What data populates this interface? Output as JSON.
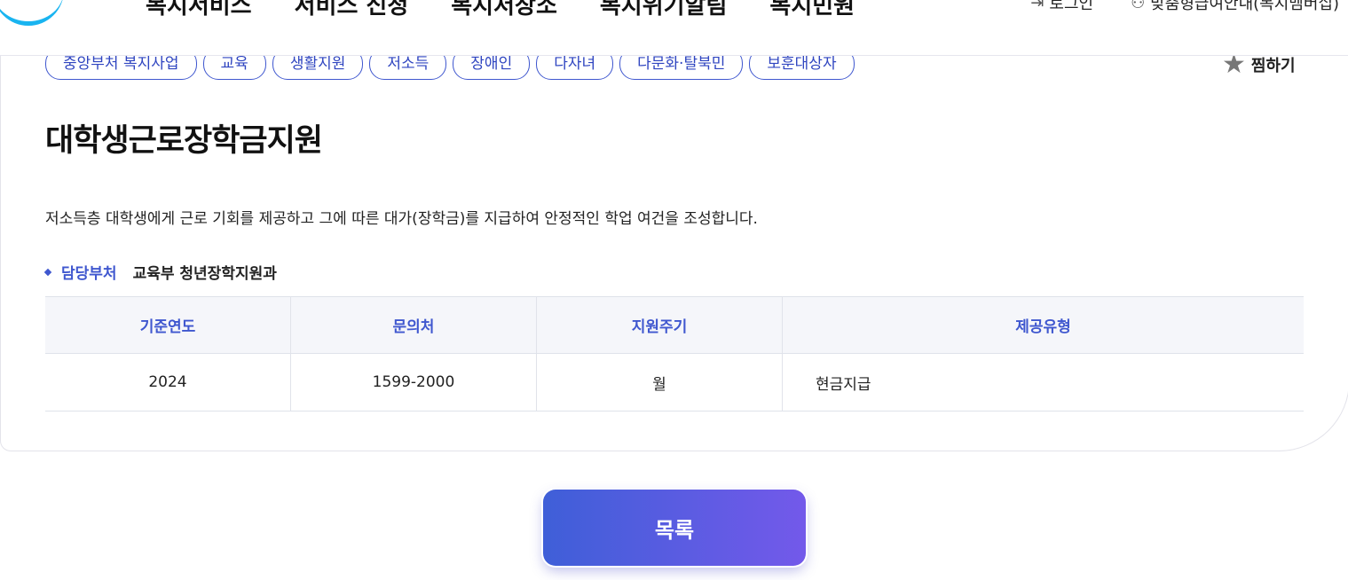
{
  "header": {
    "nav": [
      "복지서비스",
      "서비스 신청",
      "복지저장소",
      "복지위기알림",
      "복지민원"
    ],
    "login_label": "로그인",
    "guide_label": "맞춤형급여안내(복지멤버십)"
  },
  "tags": [
    "중앙부처 복지사업",
    "교육",
    "생활지원",
    "저소득",
    "장애인",
    "다자녀",
    "다문화·탈북민",
    "보훈대상자"
  ],
  "favorite_label": "찜하기",
  "title": "대학생근로장학금지원",
  "description": "저소득층 대학생에게 근로 기회를 제공하고 그에 따른 대가(장학금)를 지급하여 안정적인 학업 여건을 조성합니다.",
  "department": {
    "label": "담당부처",
    "value": "교육부 청년장학지원과"
  },
  "table": {
    "headers": [
      "기준연도",
      "문의처",
      "지원주기",
      "제공유형"
    ],
    "row": [
      "2024",
      "1599-2000",
      "월",
      "현금지급"
    ]
  },
  "list_button_label": "목록",
  "colors": {
    "accent": "#3f57cf",
    "button_gradient_start": "#3f5fd8",
    "button_gradient_end": "#7359ea",
    "logo": "#19b4f0"
  }
}
